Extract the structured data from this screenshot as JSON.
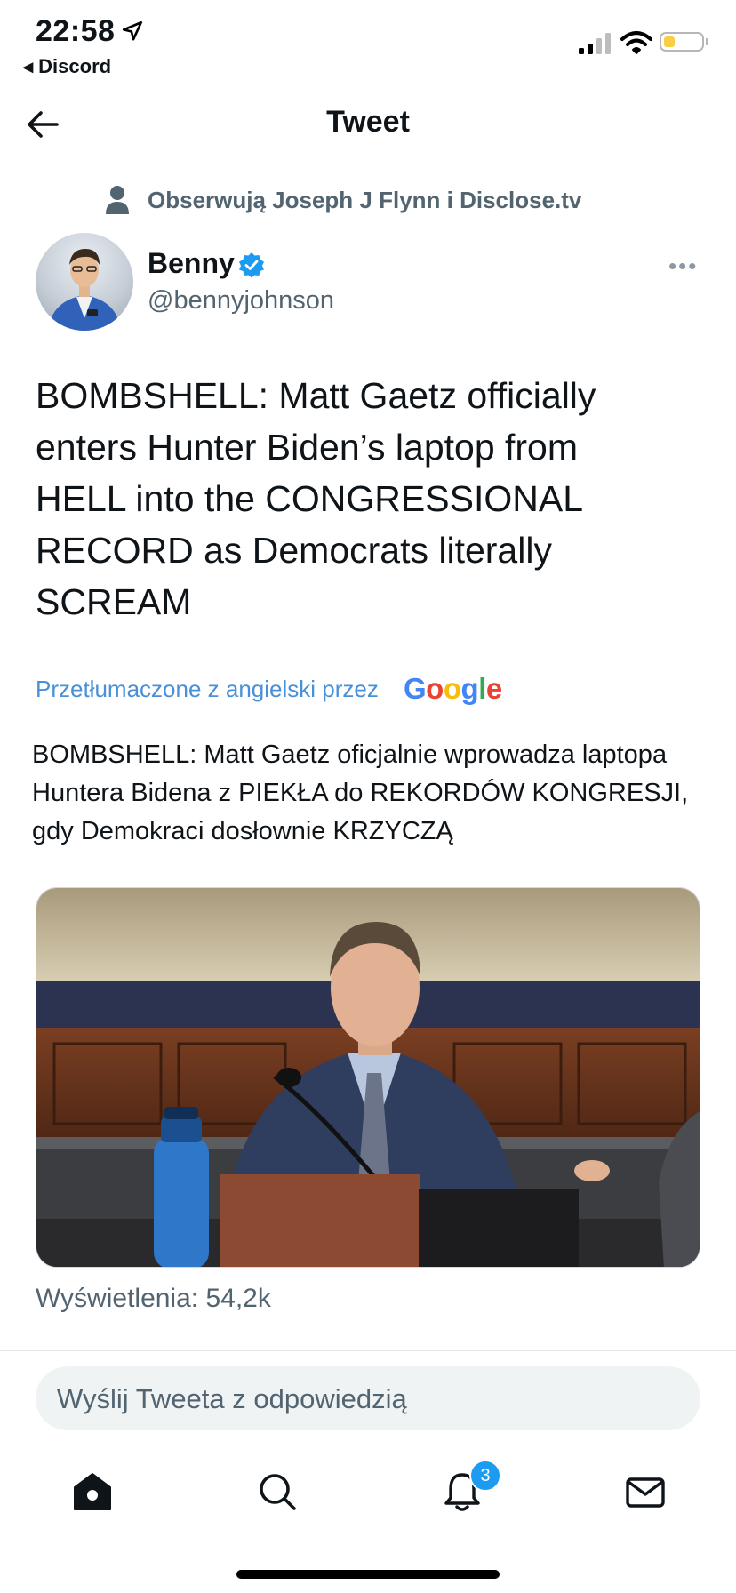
{
  "status_bar": {
    "time": "22:58",
    "back_app": "◂ Discord"
  },
  "header": {
    "title": "Tweet"
  },
  "social_context": {
    "text": "Obserwują Joseph J Flynn i Disclose.tv"
  },
  "author": {
    "name": "Benny",
    "handle": "@bennyjohnson",
    "verified": true
  },
  "tweet": {
    "text": "BOMBSHELL: Matt Gaetz officially enters Hunter Biden’s laptop from HELL into the CONGRESSIONAL RECORD as Democrats literally SCREAM",
    "translated_by": "Przetłumaczone z angielski przez",
    "translation_provider": "Google",
    "translated_text": "BOMBSHELL: Matt Gaetz oficjalnie wprowadza laptopa Huntera Bidena z PIEKŁA do REKORDÓW KONGRESJI, gdy Demokraci dosłownie KRZYCZĄ",
    "views": "Wyświetlenia: 54,2k"
  },
  "reply": {
    "placeholder": "Wyślij Tweeta z odpowiedzią"
  },
  "tab_bar": {
    "notifications_badge": "3"
  },
  "colors": {
    "accent": "#1d9bf0",
    "secondary_text": "#536471",
    "translate_link": "#4a90d9",
    "battery": "#f7ce45"
  },
  "icons": [
    "location-arrow-icon",
    "signal-icon",
    "wifi-icon",
    "battery-icon",
    "back-arrow-icon",
    "person-icon",
    "verified-badge-icon",
    "more-icon",
    "home-icon",
    "search-icon",
    "bell-icon",
    "mail-icon"
  ]
}
